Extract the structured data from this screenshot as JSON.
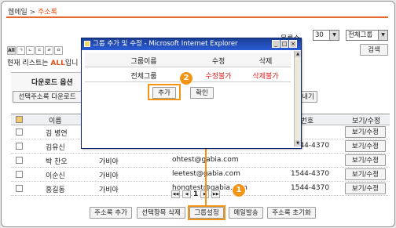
{
  "breadcrumb": {
    "root": "웹메일",
    "sep": " > ",
    "current": "주소록"
  },
  "top": {
    "per_page_label": "목록수",
    "per_page_value": "30",
    "group_select": "전체그룹",
    "search_button": "검색"
  },
  "alphabet": [
    "All",
    "ㄱ",
    "ㄴ",
    "ㄷ",
    "ㄹ",
    "ㅁ"
  ],
  "list_info": {
    "prefix": "현재 리스트는 ",
    "highlight": "ALL",
    "suffix": "입니"
  },
  "download": {
    "title": "다운로드 옵션",
    "button": "선택주소록 다운로드",
    "right_button": "내기"
  },
  "table": {
    "headers": {
      "name": "이름",
      "phone": "전화번호",
      "action": "보기/수정"
    },
    "rows": [
      {
        "name": "김 병연",
        "company": "",
        "email": "",
        "phone": "",
        "action": "보기/수정"
      },
      {
        "name": "김유신",
        "company": "",
        "email": "",
        "phone": "1544-4370",
        "action": "보기/수정"
      },
      {
        "name": "박 찬오",
        "company": "가비아",
        "email": "ohtest@gabia.com",
        "phone": "",
        "action": "보기/수정"
      },
      {
        "name": "이순신",
        "company": "가비아",
        "email": "leetest@gabia.com",
        "phone": "1544-4370",
        "action": "보기/수정"
      },
      {
        "name": "홍길동",
        "company": "가비아",
        "email": "hongtest@gabia.com",
        "phone": "1544-4370",
        "action": "보기/수정"
      }
    ]
  },
  "pager": {
    "current": "1"
  },
  "bottom_buttons": {
    "add": "주소록 추가",
    "delete": "선택항목 삭제",
    "group": "그룹설정",
    "mail": "메일발송",
    "reset": "주소록 초기화"
  },
  "popup": {
    "title": "그룹 추가 및 수정 - Microsoft Internet Explorer",
    "headers": {
      "name": "그룹이름",
      "edit": "수정",
      "delete": "삭제"
    },
    "row": {
      "name": "전체그룹",
      "edit": "수정불가",
      "delete": "삭제불가"
    },
    "add_button": "추가",
    "confirm_button": "확인"
  },
  "callouts": [
    "1",
    "2"
  ],
  "colors": {
    "accent": "#f39414",
    "highlight_text": "#e0531c",
    "denied": "#e02020",
    "title_bar": "#2a5cd6"
  }
}
